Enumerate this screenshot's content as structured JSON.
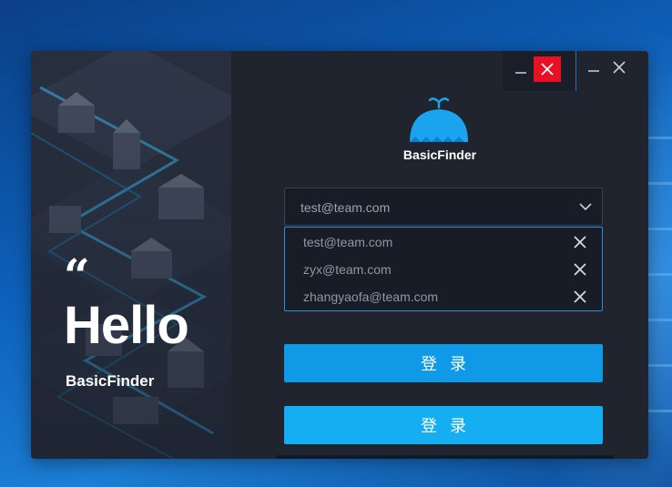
{
  "hero": {
    "quote_mark": "“",
    "greeting": "Hello",
    "brand": "BasicFinder"
  },
  "window_controls": {
    "minimize_icon": "minimize-icon",
    "close_icon": "close-icon"
  },
  "logo": {
    "text": "BasicFinder",
    "color": "#1aa3ee"
  },
  "account_field": {
    "value": "test@team.com",
    "icon": "chevron-down-icon"
  },
  "account_options": [
    {
      "email": "test@team.com"
    },
    {
      "email": "zyx@team.com"
    },
    {
      "email": "zhangyaofa@team.com"
    }
  ],
  "buttons": {
    "login_primary": "登录",
    "login_secondary": "登录"
  },
  "colors": {
    "accent": "#0f99e6",
    "accent_light": "#16aef2",
    "close_red": "#e81123"
  }
}
